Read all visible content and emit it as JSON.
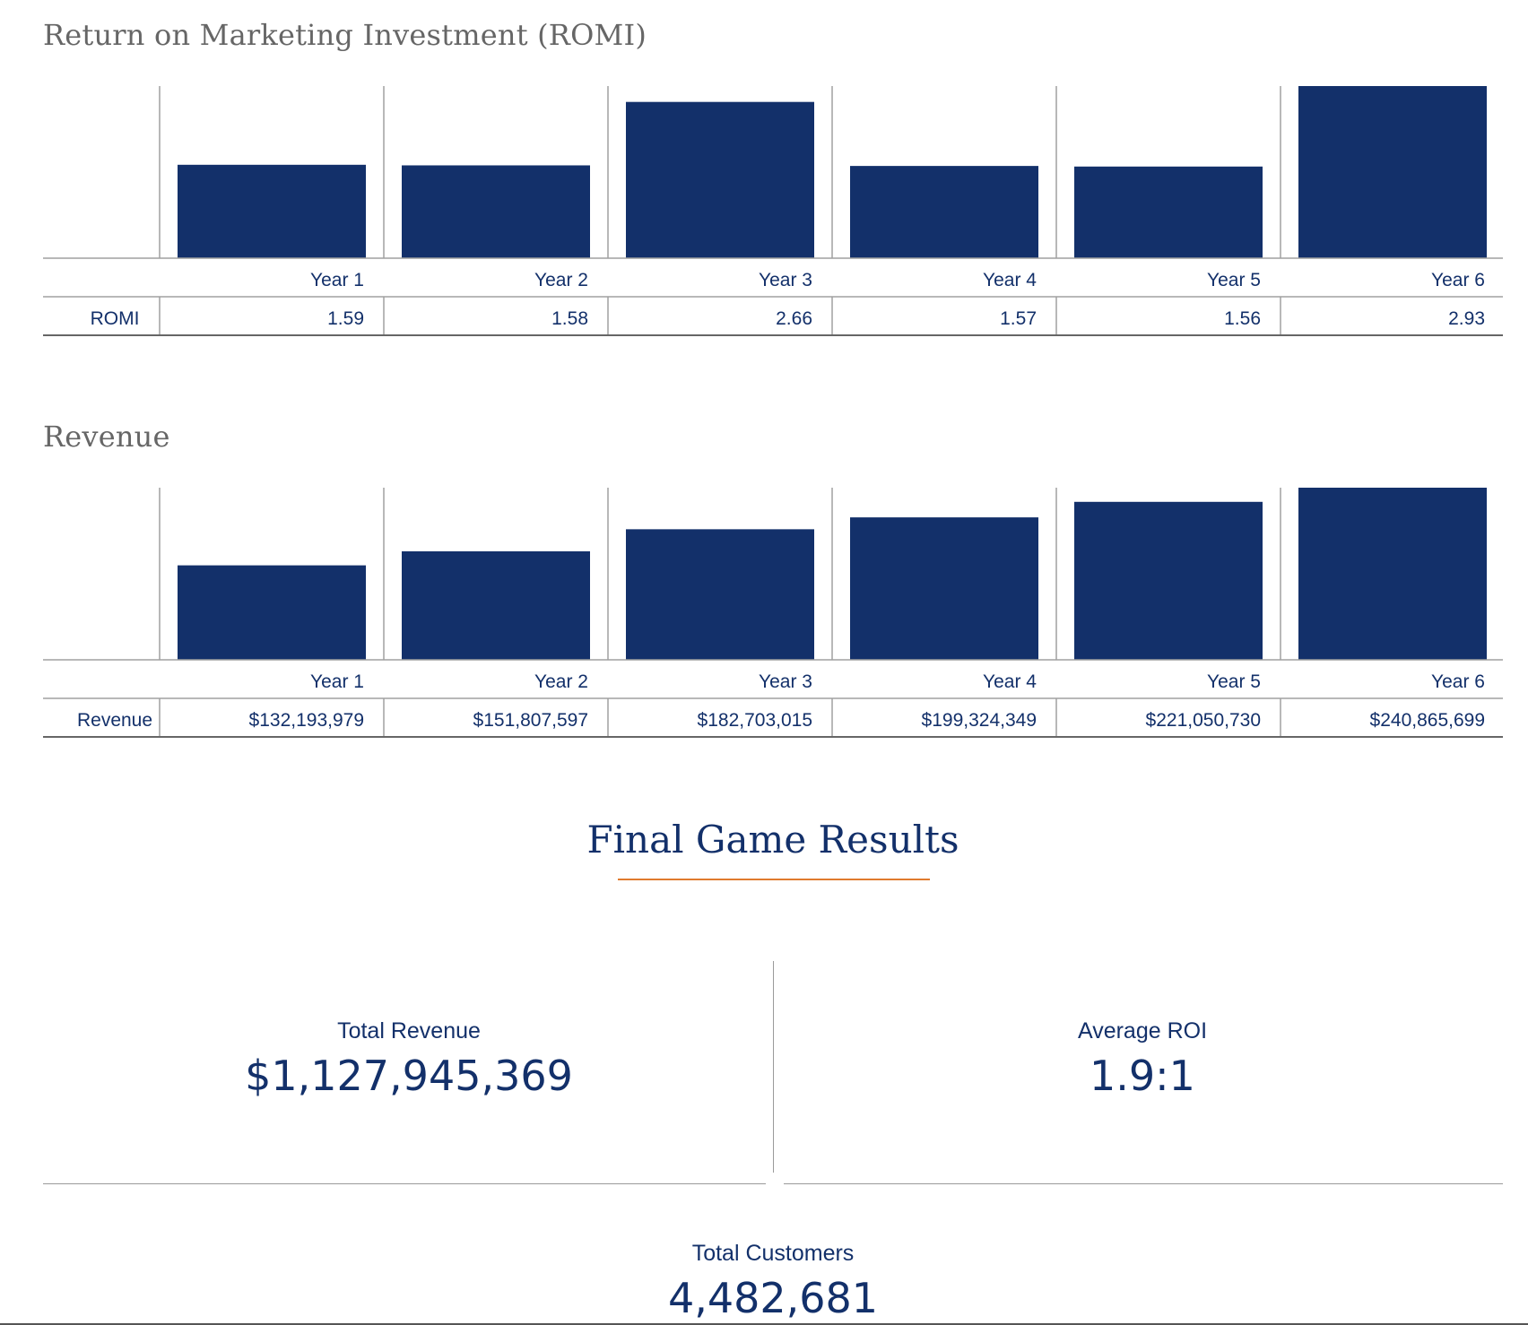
{
  "romi_section": {
    "title": "Return on Marketing Investment (ROMI)"
  },
  "revenue_section": {
    "title": "Revenue"
  },
  "chart_data": [
    {
      "type": "bar",
      "title": "Return on Marketing Investment (ROMI)",
      "categories": [
        "Year 1",
        "Year 2",
        "Year 3",
        "Year 4",
        "Year 5",
        "Year 6"
      ],
      "series": [
        {
          "name": "ROMI",
          "values": [
            1.59,
            1.58,
            2.66,
            1.57,
            1.56,
            2.93
          ]
        }
      ],
      "row_label": "ROMI",
      "value_labels": [
        "1.59",
        "1.58",
        "2.66",
        "1.57",
        "1.56",
        "2.93"
      ],
      "ylim": [
        0,
        2.93
      ],
      "grid": false,
      "bar_color": "#13306a"
    },
    {
      "type": "bar",
      "title": "Revenue",
      "categories": [
        "Year 1",
        "Year 2",
        "Year 3",
        "Year 4",
        "Year 5",
        "Year 6"
      ],
      "series": [
        {
          "name": "Revenue",
          "values": [
            132193979,
            151807597,
            182703015,
            199324349,
            221050730,
            240865699
          ]
        }
      ],
      "row_label": "Revenue",
      "value_labels": [
        "$132,193,979",
        "$151,807,597",
        "$182,703,015",
        "$199,324,349",
        "$221,050,730",
        "$240,865,699"
      ],
      "ylim": [
        0,
        240865699
      ],
      "grid": false,
      "bar_color": "#13306a"
    }
  ],
  "results": {
    "title": "Final Game Results",
    "accent_color": "#e07a2e",
    "total_revenue": {
      "label": "Total Revenue",
      "value": "$1,127,945,369"
    },
    "average_roi": {
      "label": "Average ROI",
      "value": "1.9:1"
    },
    "total_customers": {
      "label": "Total Customers",
      "value": "4,482,681"
    }
  }
}
